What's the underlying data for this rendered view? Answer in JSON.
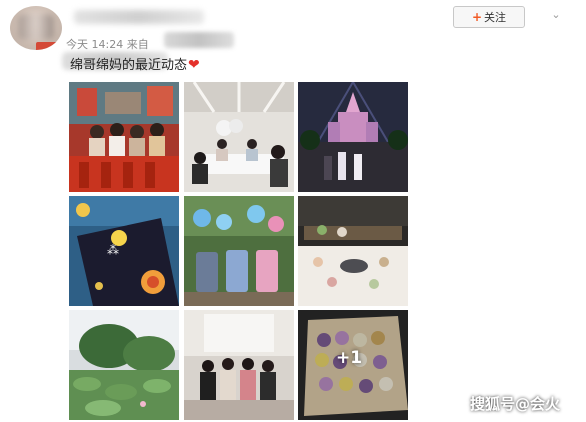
{
  "post": {
    "timestamp": "今天 14:24",
    "source_prefix": "来自",
    "text": "绵哥绵妈的最近动态",
    "heart": "❤"
  },
  "header": {
    "follow_plus": "+",
    "follow_label": "关注",
    "menu_icon": "chevron-down-icon",
    "menu_glyph": "⌄"
  },
  "images": {
    "more_count_label": "+1",
    "tiles": [
      {
        "subject": "group photo in restaurant with red chairs"
      },
      {
        "subject": "people dining at table with white flowers"
      },
      {
        "subject": "castle lit up at night"
      },
      {
        "subject": "mooncake gift box with moon design"
      },
      {
        "subject": "three strollers in front of balloons"
      },
      {
        "subject": "buffet dessert table"
      },
      {
        "subject": "lotus pond with trees"
      },
      {
        "subject": "group photo of women indoors"
      },
      {
        "subject": "tray of colorful mooncakes"
      }
    ]
  },
  "watermark": "搜狐号@会火",
  "colors": {
    "accent_orange": "#f15a24",
    "heart_red": "#e4312b",
    "meta_gray": "#8a8a8a"
  }
}
